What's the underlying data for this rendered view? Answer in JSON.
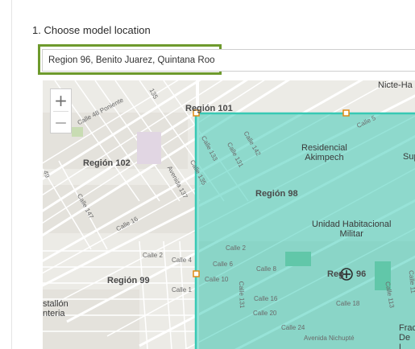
{
  "step": {
    "title": "1. Choose model location"
  },
  "location": {
    "value": "Region 96, Benito Juarez, Quintana Roo"
  },
  "map": {
    "zoom_in_label": "+",
    "zoom_out_label": "—",
    "selection_color": "#38c9b4",
    "regions": {
      "r101": "Región 101",
      "r102": "Región 102",
      "r98": "Región 98",
      "r99": "Región 99",
      "r96_prefix": "Reg",
      "r96_suffix": "96"
    },
    "areas": {
      "residencial": "Residencial\nAkimpech",
      "unidad": "Unidad Habitacional\nMilitar",
      "nicte": "Nicte-Ha",
      "sup": "Sup",
      "frac": "Frac\nDe L",
      "stallon": "stallón\nnteria"
    },
    "streets": {
      "c48": "Calle 48 Poniente",
      "c135top": "135",
      "c5": "Calle 5",
      "c133": "Calle 133",
      "c131": "Calle 131",
      "c142": "Calle 142",
      "c147": "Calle 147",
      "c16a": "Calle 16",
      "av137": "Avenida 137",
      "c135mid": "Calle 135",
      "c49": "49",
      "c2a": "Calle 2",
      "c4": "Calle 4",
      "c1": "Calle 1",
      "c2b": "Calle 2",
      "c6": "Calle 6",
      "c8": "Calle 8",
      "c10": "Calle 10",
      "c131b": "Calle 131",
      "c16b": "Calle 16",
      "c20": "Calle 20",
      "c18": "Calle 18",
      "c24": "Calle 24",
      "c113": "Calle 113",
      "c11": "Calle 11",
      "nichupte": "Avenida Nichupté"
    }
  }
}
